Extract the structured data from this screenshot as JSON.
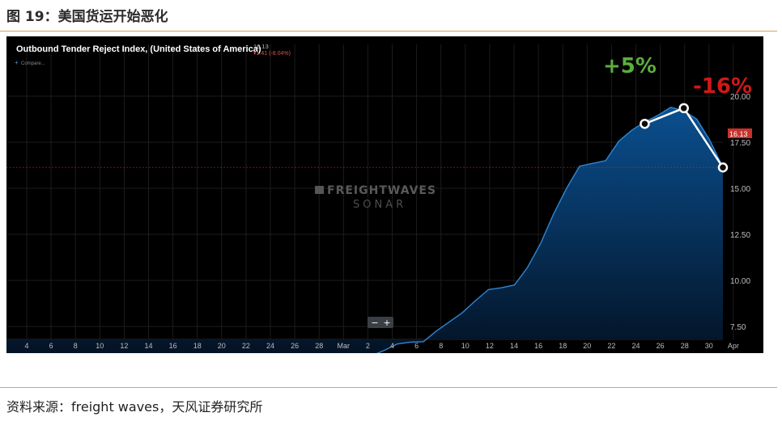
{
  "figure_title": "图 19：美国货运开始恶化",
  "source_note": "资料来源：freight waves，天风证券研究所",
  "chart_data": {
    "type": "area",
    "title": "Outbound Tender Reject Index, (United States of America)",
    "header_value": "16.13",
    "header_change": "▾1.41 (-8.04%)",
    "compare_label": "Compare...",
    "watermark_top": "FREIGHTWAVES",
    "watermark_bottom": "SONAR",
    "zoom_out_label": "−",
    "zoom_in_label": "+",
    "current_value_label": "16.13",
    "ylim": [
      5.0,
      21.0
    ],
    "y_ticks": [
      "7.50",
      "10.00",
      "12.50",
      "15.00",
      "17.50",
      "20.00"
    ],
    "x_tick_labels": [
      "4",
      "6",
      "8",
      "10",
      "12",
      "14",
      "16",
      "18",
      "20",
      "22",
      "24",
      "26",
      "28",
      "Mar",
      "2",
      "4",
      "6",
      "8",
      "10",
      "12",
      "14",
      "16",
      "18",
      "20",
      "22",
      "24",
      "26",
      "28",
      "30",
      "Apr"
    ],
    "series": [
      {
        "values": [
          5.75,
          5.65,
          5.55,
          5.62,
          5.6,
          5.58,
          5.58,
          5.68,
          5.68,
          5.67,
          5.66,
          5.68,
          5.7,
          5.7,
          5.7,
          5.68,
          5.8,
          5.78,
          5.72,
          5.72,
          5.68,
          5.68,
          5.48,
          5.43,
          5.4,
          5.4,
          5.45,
          5.6,
          5.9,
          6.2,
          6.55,
          6.65,
          6.67,
          7.25,
          7.75,
          8.25,
          8.9,
          9.5,
          9.6,
          9.75,
          10.7,
          12.0,
          13.6,
          15.0,
          16.2,
          16.35,
          16.5,
          17.55,
          18.15,
          18.6,
          18.95,
          19.4,
          19.2,
          18.75,
          17.6,
          16.13
        ]
      }
    ],
    "annotations": [
      {
        "text": "+5%",
        "color": "#5cad3f"
      },
      {
        "text": "-16%",
        "color": "#d01818"
      }
    ],
    "highlight_points": [
      {
        "x_index": 49,
        "value": 18.5
      },
      {
        "x_index": 52,
        "value": 19.35
      },
      {
        "x_index": 55,
        "value": 16.13
      }
    ],
    "colors": {
      "line": "#2f86d6",
      "area_top": "#0a4f8f",
      "area_bottom": "#031020",
      "current_tag": "#c8312b"
    }
  }
}
